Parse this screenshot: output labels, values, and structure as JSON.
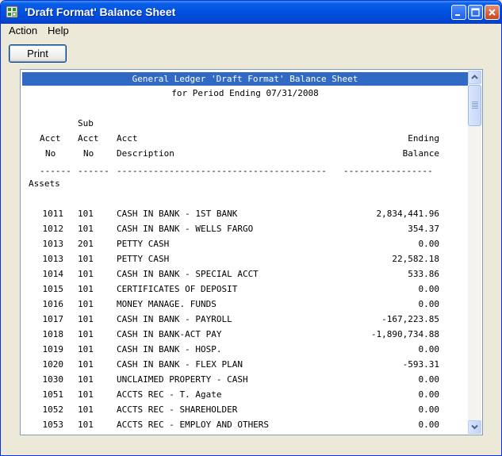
{
  "window": {
    "title": "'Draft Format' Balance Sheet"
  },
  "menu": [
    {
      "label": "Action"
    },
    {
      "label": "Help"
    }
  ],
  "toolbar": {
    "print_label": "Print"
  },
  "report": {
    "title": "General Ledger 'Draft Format' Balance Sheet",
    "period": "for Period Ending 07/31/2008",
    "headers": {
      "sub": "Sub",
      "acct": "Acct",
      "sub_acct": "Acct",
      "acct_desc": "Acct",
      "ending": "Ending",
      "no": "No",
      "sub_no": "No",
      "description": "Description",
      "balance": "Balance"
    },
    "separators": {
      "acct": "------",
      "sub": "------",
      "desc": "----------------------------------------",
      "bal": "-----------------"
    },
    "section": "Assets",
    "rows": [
      {
        "acct": "1011",
        "sub": "101",
        "desc": "CASH IN BANK - 1ST BANK",
        "balance": "2,834,441.96"
      },
      {
        "acct": "1012",
        "sub": "101",
        "desc": "CASH IN BANK - WELLS FARGO",
        "balance": "354.37"
      },
      {
        "acct": "1013",
        "sub": "201",
        "desc": "PETTY CASH",
        "balance": "0.00"
      },
      {
        "acct": "1013",
        "sub": "101",
        "desc": "PETTY CASH",
        "balance": "22,582.18"
      },
      {
        "acct": "1014",
        "sub": "101",
        "desc": "CASH IN BANK - SPECIAL ACCT",
        "balance": "533.86"
      },
      {
        "acct": "1015",
        "sub": "101",
        "desc": "CERTIFICATES OF DEPOSIT",
        "balance": "0.00"
      },
      {
        "acct": "1016",
        "sub": "101",
        "desc": "MONEY MANAGE. FUNDS",
        "balance": "0.00"
      },
      {
        "acct": "1017",
        "sub": "101",
        "desc": "CASH IN BANK - PAYROLL",
        "balance": "-167,223.85"
      },
      {
        "acct": "1018",
        "sub": "101",
        "desc": "CASH IN BANK-ACT PAY",
        "balance": "-1,890,734.88"
      },
      {
        "acct": "1019",
        "sub": "101",
        "desc": "CASH IN BANK - HOSP.",
        "balance": "0.00"
      },
      {
        "acct": "1020",
        "sub": "101",
        "desc": "CASH IN BANK - FLEX PLAN",
        "balance": "-593.31"
      },
      {
        "acct": "1030",
        "sub": "101",
        "desc": "UNCLAIMED PROPERTY - CASH",
        "balance": "0.00"
      },
      {
        "acct": "1051",
        "sub": "101",
        "desc": "ACCTS REC - T. Agate",
        "balance": "0.00"
      },
      {
        "acct": "1052",
        "sub": "101",
        "desc": "ACCTS REC - SHAREHOLDER",
        "balance": "0.00"
      },
      {
        "acct": "1053",
        "sub": "101",
        "desc": "ACCTS REC - EMPLOY AND OTHERS",
        "balance": "0.00"
      }
    ]
  },
  "colors": {
    "titlebar": "#0053e1",
    "report_header_bg": "#316ac5",
    "window_bg": "#ece9d8"
  }
}
